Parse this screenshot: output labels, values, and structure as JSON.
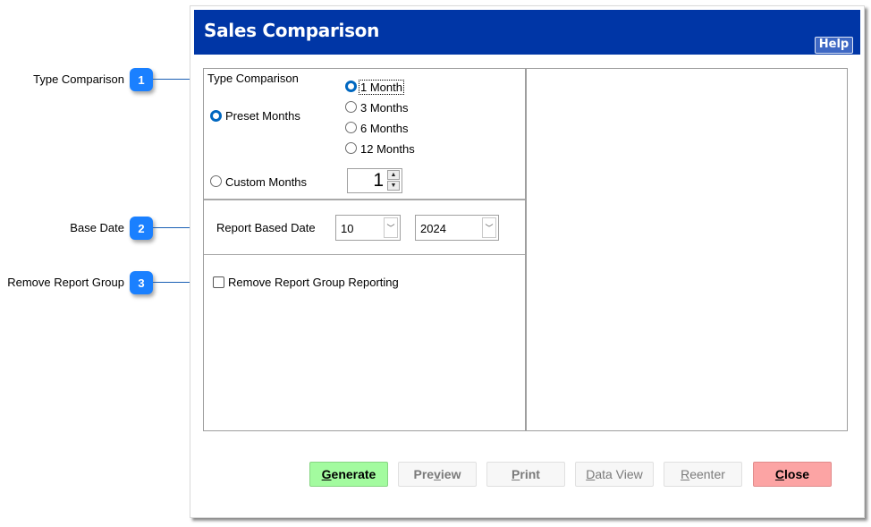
{
  "callouts": [
    {
      "number": "1",
      "label": "Type Comparison"
    },
    {
      "number": "2",
      "label": "Base Date"
    },
    {
      "number": "3",
      "label": "Remove Report Group"
    }
  ],
  "dialog": {
    "title": "Sales Comparison",
    "help_label": "Help",
    "type_comparison": {
      "heading": "Type Comparison",
      "preset_label": "Preset Months",
      "preset_selected": true,
      "custom_label": "Custom Months",
      "custom_selected": false,
      "month_options": [
        {
          "label": "1 Month",
          "selected": true
        },
        {
          "label": "3 Months",
          "selected": false
        },
        {
          "label": "6 Months",
          "selected": false
        },
        {
          "label": "12 Months",
          "selected": false
        }
      ],
      "custom_months_value": "1"
    },
    "base_date": {
      "label": "Report Based Date",
      "month_value": "10",
      "year_value": "2024"
    },
    "report_group": {
      "label": "Remove Report Group Reporting",
      "checked": false
    },
    "buttons": {
      "generate": {
        "accel": "G",
        "rest": "enerate",
        "enabled": true,
        "color": "#a3fb9f"
      },
      "preview": {
        "pre": "Pre",
        "accel": "v",
        "rest": "iew",
        "enabled": false
      },
      "print": {
        "accel": "P",
        "rest": "rint",
        "enabled": false
      },
      "data_view": {
        "accel": "D",
        "rest": "ata View",
        "enabled": false
      },
      "reenter": {
        "accel": "R",
        "rest": "eenter",
        "enabled": false
      },
      "close": {
        "accel": "C",
        "rest": "lose",
        "enabled": true,
        "color": "#fca4a4"
      }
    }
  },
  "colors": {
    "titlebar": "#0036a6",
    "callout_badge": "#1a80ff",
    "radio_selected": "#0067c0"
  }
}
